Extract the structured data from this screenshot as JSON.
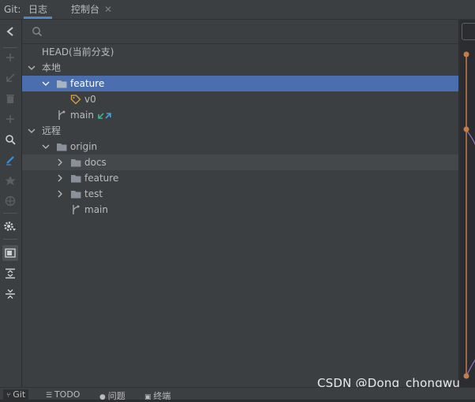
{
  "top": {
    "tool_label": "Git:",
    "tabs": [
      {
        "label": "日志"
      },
      {
        "label": "控制台"
      }
    ]
  },
  "tree": {
    "head_label": "HEAD(当前分支)",
    "local_label": "本地",
    "local_folder": "feature",
    "tag_label": "v0",
    "local_main": "main",
    "remote_label": "远程",
    "origin_label": "origin",
    "remote_folders": [
      "docs",
      "feature",
      "test"
    ],
    "remote_main": "main"
  },
  "bottom": {
    "tabs": [
      {
        "label": "Git"
      },
      {
        "label": "TODO"
      },
      {
        "label": "问题"
      },
      {
        "label": "终端"
      }
    ]
  },
  "watermark": "CSDN @Dong_chongwu",
  "colors": {
    "selection": "#4b6eaf",
    "tag": "#d9a343",
    "folder": "#8a9199",
    "incoming": "#3bb38c",
    "outgoing": "#4a9fd8",
    "graph_node": "#c47d4c"
  }
}
